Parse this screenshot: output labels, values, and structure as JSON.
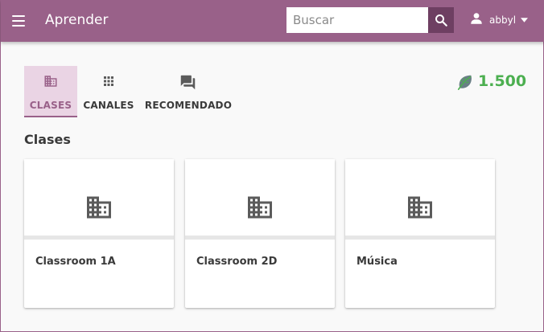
{
  "colors": {
    "brand": "#996189",
    "brand_dark": "#6e3f62",
    "active_tab_bg": "#ead4e4",
    "points_green": "#4caf50",
    "text": "#3a3a3a",
    "icon_grey": "#5b5b5b"
  },
  "header": {
    "title": "Aprender",
    "search_placeholder": "Buscar",
    "search_value": "",
    "username": "abbyl",
    "icons": {
      "menu": "menu-icon",
      "search": "search-icon",
      "user": "person-icon",
      "dropdown": "caret-down-icon"
    }
  },
  "tabs": [
    {
      "label": "CLASES",
      "icon": "building-icon",
      "active": true
    },
    {
      "label": "CANALES",
      "icon": "apps-grid-icon",
      "active": false
    },
    {
      "label": "RECOMENDADO",
      "icon": "forum-icon",
      "active": false
    }
  ],
  "points": {
    "value": "1.500",
    "icon": "leaf-icon"
  },
  "section": {
    "title": "Clases"
  },
  "classes": [
    {
      "name": "Classroom 1A",
      "icon": "building-icon"
    },
    {
      "name": "Classroom 2D",
      "icon": "building-icon"
    },
    {
      "name": "Música",
      "icon": "building-icon"
    }
  ]
}
